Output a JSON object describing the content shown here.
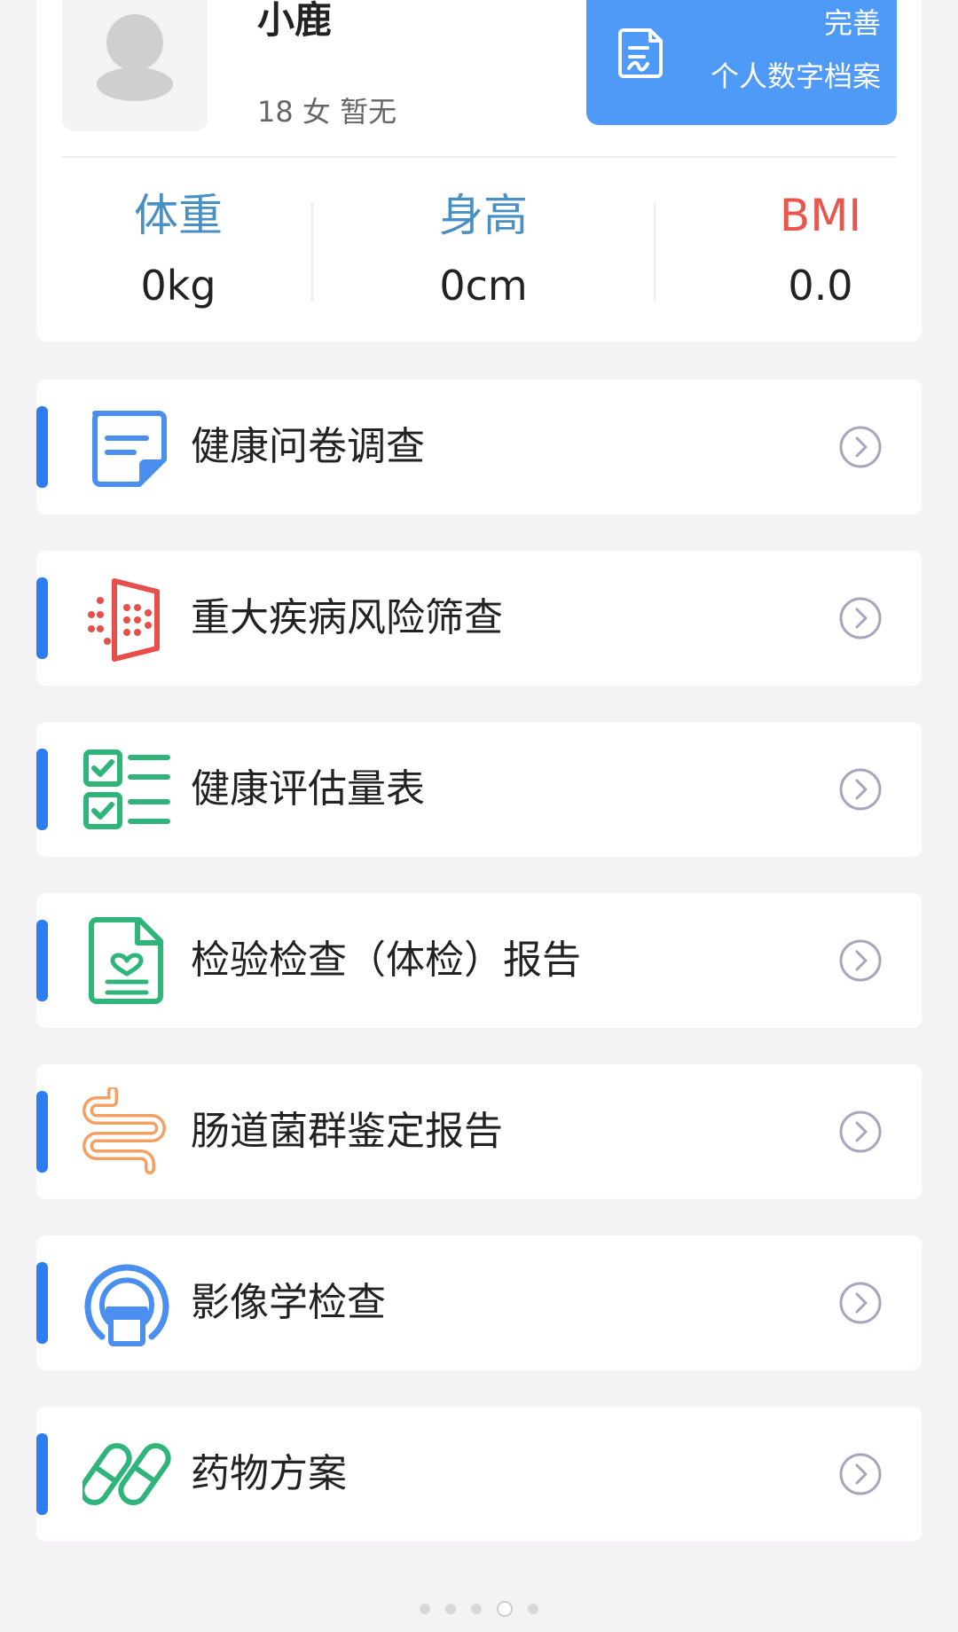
{
  "profile": {
    "name": "小鹿",
    "meta": "18 女 暂无",
    "complete_button": {
      "line1": "完善",
      "line2": "个人数字档案",
      "color": "#4f9af6"
    },
    "stats": [
      {
        "label": "体重",
        "value": "0kg",
        "color": "#4a8fc4"
      },
      {
        "label": "身高",
        "value": "0cm",
        "color": "#4a8fc4"
      },
      {
        "label": "BMI",
        "value": "0.0",
        "color": "#e8574d"
      }
    ]
  },
  "menu": {
    "accent_color": "#2b7df0",
    "items": [
      {
        "label": "健康问卷调查",
        "icon": "questionnaire-icon",
        "color": "#4a8ff0"
      },
      {
        "label": "重大疾病风险筛查",
        "icon": "risk-screening-icon",
        "color": "#e84f4a"
      },
      {
        "label": "健康评估量表",
        "icon": "checklist-icon",
        "color": "#2fb57a"
      },
      {
        "label": "检验检查（体检）报告",
        "icon": "medical-report-icon",
        "color": "#2fb57a"
      },
      {
        "label": "肠道菌群鉴定报告",
        "icon": "intestine-icon",
        "color": "#f3a062"
      },
      {
        "label": "影像学检查",
        "icon": "imaging-scanner-icon",
        "color": "#4a8ff0"
      },
      {
        "label": "药物方案",
        "icon": "pills-icon",
        "color": "#2fb57a"
      }
    ]
  },
  "pager": {
    "count": 5,
    "active_index": 3
  }
}
